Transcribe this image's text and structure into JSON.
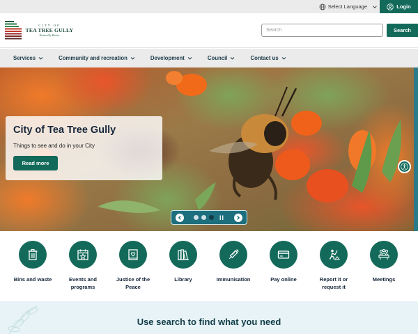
{
  "utility": {
    "language_label": "Select Language",
    "login_label": "Login"
  },
  "header": {
    "logo": {
      "city_of": "CITY OF",
      "name": "TEA TREE GULLY",
      "tagline": "Naturally Better"
    },
    "search": {
      "placeholder": "Search",
      "button_label": "Search"
    }
  },
  "nav": {
    "items": [
      {
        "label": "Services"
      },
      {
        "label": "Community and recreation"
      },
      {
        "label": "Development"
      },
      {
        "label": "Council"
      },
      {
        "label": "Contact us"
      }
    ]
  },
  "hero": {
    "title": "City of Tea Tree Gully",
    "subtitle": "Things to see and do in your City",
    "button_label": "Read more",
    "carousel": {
      "slide_count": 3,
      "active_index": 2,
      "pause_symbol": "II"
    }
  },
  "quick_links": [
    {
      "label": "Bins and waste",
      "icon": "bin-icon"
    },
    {
      "label": "Events and programs",
      "icon": "calendar-star-icon"
    },
    {
      "label": "Justice of the Peace",
      "icon": "book-heart-icon"
    },
    {
      "label": "Library",
      "icon": "books-icon"
    },
    {
      "label": "Immunisation",
      "icon": "syringe-icon"
    },
    {
      "label": "Pay online",
      "icon": "credit-card-icon"
    },
    {
      "label": "Report it or request it",
      "icon": "worker-icon"
    },
    {
      "label": "Meetings",
      "icon": "meeting-icon"
    }
  ],
  "search_band": {
    "title": "Use search to find what you need"
  },
  "colors": {
    "primary": "#136a5a",
    "nav_bg": "#ebebeb",
    "band_bg": "#e7f3f6",
    "heading": "#15253a"
  }
}
